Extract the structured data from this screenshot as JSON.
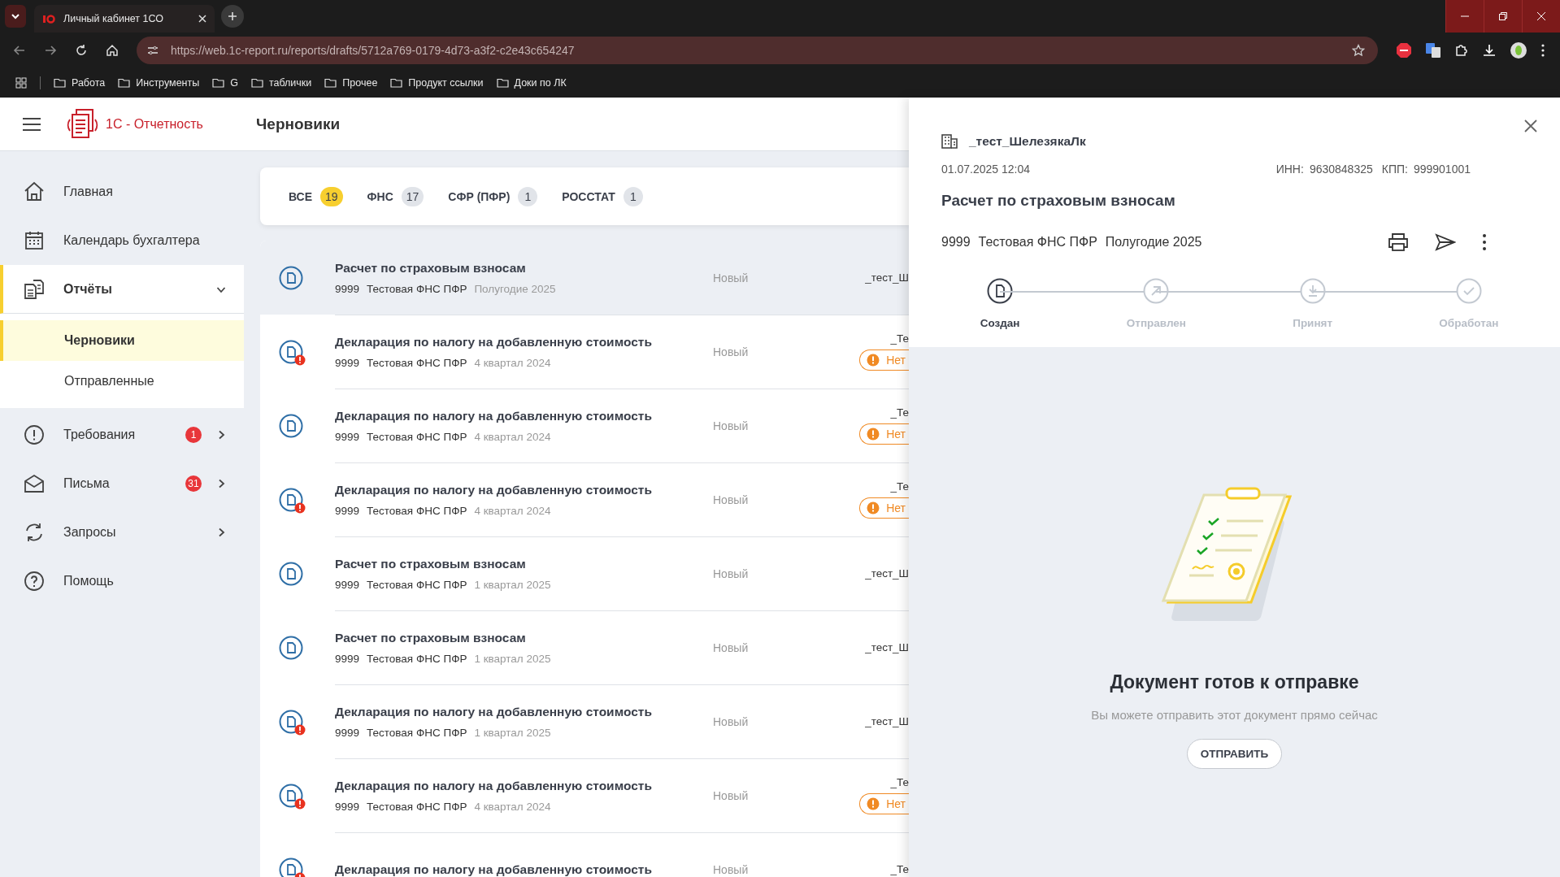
{
  "browser": {
    "tab_title": "Личный кабинет 1СО",
    "url": "https://web.1c-report.ru/reports/drafts/5712a769-0179-4d73-a3f2-c2e43c654247",
    "bookmarks": [
      "Работа",
      "Инструменты",
      "G",
      "таблички",
      "Прочее",
      "Продукт ссылки",
      "Доки по ЛК"
    ]
  },
  "app": {
    "logo_text": "1С - Отчетность",
    "page_title": "Черновики"
  },
  "sidebar": {
    "items": [
      {
        "kind": "home",
        "label": "Главная",
        "selected": false
      },
      {
        "kind": "calendar",
        "label": "Календарь бухгалтера",
        "selected": false
      },
      {
        "kind": "reports",
        "label": "Отчёты",
        "selected": true,
        "expanded": true,
        "children": [
          {
            "label": "Черновики",
            "selected": true
          },
          {
            "label": "Отправленные",
            "selected": false
          }
        ]
      },
      {
        "kind": "alert",
        "label": "Требования",
        "selected": false,
        "expanded": false,
        "badge": "1"
      },
      {
        "kind": "mail",
        "label": "Письма",
        "selected": false,
        "expanded": false,
        "badge": "31"
      },
      {
        "kind": "sync",
        "label": "Запросы",
        "selected": false,
        "expanded": false
      },
      {
        "kind": "help",
        "label": "Помощь",
        "selected": false
      }
    ]
  },
  "filters": [
    {
      "label": "ВСЕ",
      "count": "19",
      "selected": true
    },
    {
      "label": "ФНС",
      "count": "17",
      "selected": false
    },
    {
      "label": "СФР (ПФР)",
      "count": "1",
      "selected": false
    },
    {
      "label": "РОССТАТ",
      "count": "1",
      "selected": false
    }
  ],
  "rows": [
    {
      "title": "Расчет по страховым взносам",
      "code": "9999",
      "org": "Тестовая ФНС ПФР",
      "period": "Полугодие 2025",
      "status": "Новый",
      "owner": "_тест_Ш",
      "error": false,
      "selected": true
    },
    {
      "title": "Декларация по налогу на добавленную стоимость",
      "code": "9999",
      "org": "Тестовая ФНС ПФР",
      "period": "4 квартал 2024",
      "status": "Новый",
      "owner": "_Те",
      "warning": "Нет",
      "error": true,
      "selected": false
    },
    {
      "title": "Декларация по налогу на добавленную стоимость",
      "code": "9999",
      "org": "Тестовая ФНС ПФР",
      "period": "4 квартал 2024",
      "status": "Новый",
      "owner": "_Те",
      "warning": "Нет",
      "error": false,
      "selected": false
    },
    {
      "title": "Декларация по налогу на добавленную стоимость",
      "code": "9999",
      "org": "Тестовая ФНС ПФР",
      "period": "4 квартал 2024",
      "status": "Новый",
      "owner": "_Те",
      "warning": "Нет",
      "error": true,
      "selected": false
    },
    {
      "title": "Расчет по страховым взносам",
      "code": "9999",
      "org": "Тестовая ФНС ПФР",
      "period": "1 квартал 2025",
      "status": "Новый",
      "owner": "_тест_Ш",
      "error": false,
      "selected": false
    },
    {
      "title": "Расчет по страховым взносам",
      "code": "9999",
      "org": "Тестовая ФНС ПФР",
      "period": "1 квартал 2025",
      "status": "Новый",
      "owner": "_тест_Ш",
      "error": false,
      "selected": false
    },
    {
      "title": "Декларация по налогу на добавленную стоимость",
      "code": "9999",
      "org": "Тестовая ФНС ПФР",
      "period": "1 квартал 2025",
      "status": "Новый",
      "owner": "_тест_Ш",
      "error": true,
      "selected": false
    },
    {
      "title": "Декларация по налогу на добавленную стоимость",
      "code": "9999",
      "org": "Тестовая ФНС ПФР",
      "period": "4 квартал 2024",
      "status": "Новый",
      "owner": "_Те",
      "warning": "Нет",
      "error": true,
      "selected": false
    },
    {
      "title": "Декларация по налогу на добавленную стоимость",
      "status": "Новый",
      "owner": "_Те",
      "error": true,
      "selected": false
    }
  ],
  "panel": {
    "org": "_тест_ШелезякаЛк",
    "date": "01.07.2025 12:04",
    "inn_label": "ИНН:",
    "inn": "9630848325",
    "kpp_label": "КПП:",
    "kpp": "999901001",
    "title": "Расчет по страховым взносам",
    "code": "9999",
    "org_short": "Тестовая ФНС ПФР",
    "period": "Полугодие 2025",
    "steps": [
      {
        "kind": "created",
        "label": "Создан",
        "active": true
      },
      {
        "kind": "sent",
        "label": "Отправлен",
        "active": false
      },
      {
        "kind": "accepted",
        "label": "Принят",
        "active": false
      },
      {
        "kind": "processed",
        "label": "Обработан",
        "active": false
      }
    ],
    "empty_title": "Документ готов к отправке",
    "empty_text": "Вы можете отправить этот документ прямо сейчас",
    "button": "ОТПРАВИТЬ"
  }
}
